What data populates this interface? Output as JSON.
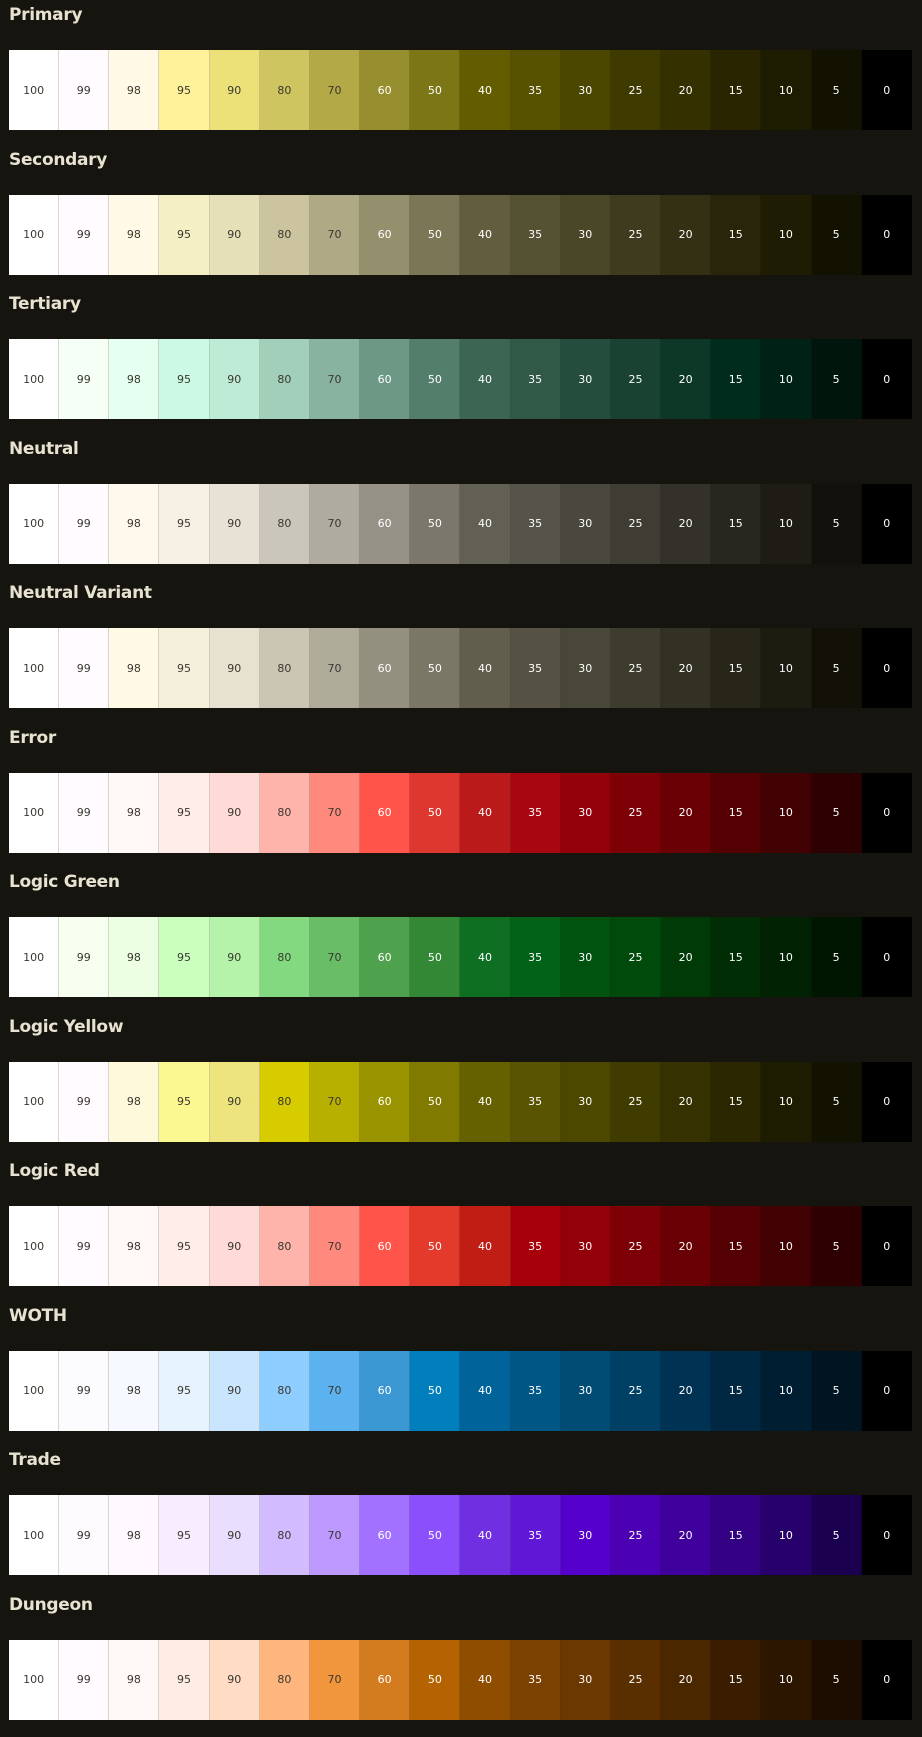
{
  "colors": {
    "background": "#15140e",
    "title_text": "#e8e2d0"
  },
  "tones": [
    "100",
    "99",
    "98",
    "95",
    "90",
    "80",
    "70",
    "60",
    "50",
    "40",
    "35",
    "30",
    "25",
    "20",
    "15",
    "10",
    "5",
    "0"
  ],
  "palettes": [
    {
      "name": "Primary",
      "swatches": [
        "#ffffff",
        "#fffbff",
        "#fff9e5",
        "#fff09a",
        "#ece179",
        "#cfc560",
        "#b3a947",
        "#978f2f",
        "#7d7616",
        "#645d00",
        "#575200",
        "#4b4600",
        "#3f3b00",
        "#343000",
        "#292500",
        "#1e1c00",
        "#131100",
        "#000000"
      ]
    },
    {
      "name": "Secondary",
      "swatches": [
        "#ffffff",
        "#fffbff",
        "#fff9e5",
        "#f4efc5",
        "#e6e0b9",
        "#cbc49e",
        "#afa985",
        "#948f6c",
        "#7b7655",
        "#615d3e",
        "#555133",
        "#4a4628",
        "#3e3b1e",
        "#333014",
        "#28250a",
        "#1e1c02",
        "#131100",
        "#000000"
      ]
    },
    {
      "name": "Tertiary",
      "swatches": [
        "#ffffff",
        "#f5fff6",
        "#e5fff0",
        "#cbf9e3",
        "#bdebd5",
        "#a1cfba",
        "#87b39f",
        "#6d9885",
        "#547e6c",
        "#3c6554",
        "#305948",
        "#244d3d",
        "#194232",
        "#0d3727",
        "#002c1e",
        "#002115",
        "#00150c",
        "#000000"
      ]
    },
    {
      "name": "Neutral",
      "swatches": [
        "#ffffff",
        "#fffbff",
        "#fff9ed",
        "#f6f0e4",
        "#e8e2d6",
        "#cbc6bb",
        "#b0aba0",
        "#959186",
        "#7b776d",
        "#625f55",
        "#56534a",
        "#4a473f",
        "#3f3c34",
        "#33312a",
        "#28271f",
        "#1e1c15",
        "#12110b",
        "#000000"
      ]
    },
    {
      "name": "Neutral Variant",
      "swatches": [
        "#ffffff",
        "#fffbff",
        "#fff9e5",
        "#f5f0dc",
        "#e7e2cf",
        "#cac6b3",
        "#afab99",
        "#94907f",
        "#7a7766",
        "#615e4e",
        "#555243",
        "#494738",
        "#3e3c2d",
        "#323123",
        "#282619",
        "#1d1c10",
        "#131107",
        "#000000"
      ]
    },
    {
      "name": "Error",
      "swatches": [
        "#ffffff",
        "#fffbff",
        "#fff8f7",
        "#ffedea",
        "#ffdad6",
        "#ffb4ab",
        "#ff897d",
        "#ff5449",
        "#de3730",
        "#ba1a1a",
        "#a80710",
        "#93000a",
        "#7e0007",
        "#690005",
        "#540003",
        "#410002",
        "#2d0001",
        "#000000"
      ]
    },
    {
      "name": "Logic Green",
      "swatches": [
        "#ffffff",
        "#f6fff0",
        "#edffe3",
        "#cbffbe",
        "#b4f3a9",
        "#83d97f",
        "#68bd66",
        "#4ea24e",
        "#338836",
        "#0e6e22",
        "#006217",
        "#00530f",
        "#004a0c",
        "#003a07",
        "#002d04",
        "#002202",
        "#001601",
        "#000000"
      ]
    },
    {
      "name": "Logic Yellow",
      "swatches": [
        "#ffffff",
        "#fffbff",
        "#fff9db",
        "#fbf791",
        "#eee47e",
        "#d6cc00",
        "#b8b000",
        "#9a9400",
        "#807a00",
        "#666100",
        "#595400",
        "#4c4800",
        "#403c00",
        "#353100",
        "#292600",
        "#1e1c00",
        "#131100",
        "#000000"
      ]
    },
    {
      "name": "Logic Red",
      "swatches": [
        "#ffffff",
        "#fffbff",
        "#fff8f7",
        "#ffedea",
        "#ffdad6",
        "#ffb4ab",
        "#ff897d",
        "#ff5449",
        "#e33a2c",
        "#c01d15",
        "#a8000a",
        "#930009",
        "#7e0007",
        "#690005",
        "#540003",
        "#410002",
        "#2d0001",
        "#000000"
      ]
    },
    {
      "name": "WOTH",
      "swatches": [
        "#ffffff",
        "#fcfcff",
        "#f6f9ff",
        "#e7f2ff",
        "#cae6ff",
        "#8dcdff",
        "#5bb2ee",
        "#3a97d2",
        "#007fbc",
        "#00649a",
        "#005786",
        "#004c75",
        "#004064",
        "#003353",
        "#002843",
        "#001e32",
        "#001421",
        "#000000"
      ]
    },
    {
      "name": "Trade",
      "swatches": [
        "#ffffff",
        "#fefbff",
        "#fff8ff",
        "#f7edff",
        "#eadeff",
        "#d2bbff",
        "#bc98ff",
        "#a271ff",
        "#8b4ffb",
        "#7030e2",
        "#6118d6",
        "#5600cb",
        "#4b00b4",
        "#3f009c",
        "#340083",
        "#27006b",
        "#1b0050",
        "#000000"
      ]
    },
    {
      "name": "Dungeon",
      "swatches": [
        "#ffffff",
        "#fffbff",
        "#fff8f6",
        "#ffede3",
        "#ffdcc3",
        "#ffb67e",
        "#f2963d",
        "#d37b1f",
        "#b46300",
        "#8f4d00",
        "#7b4100",
        "#6a3800",
        "#5a2f00",
        "#4b2700",
        "#3a1d00",
        "#2c1600",
        "#1d0d00",
        "#000000"
      ]
    }
  ]
}
